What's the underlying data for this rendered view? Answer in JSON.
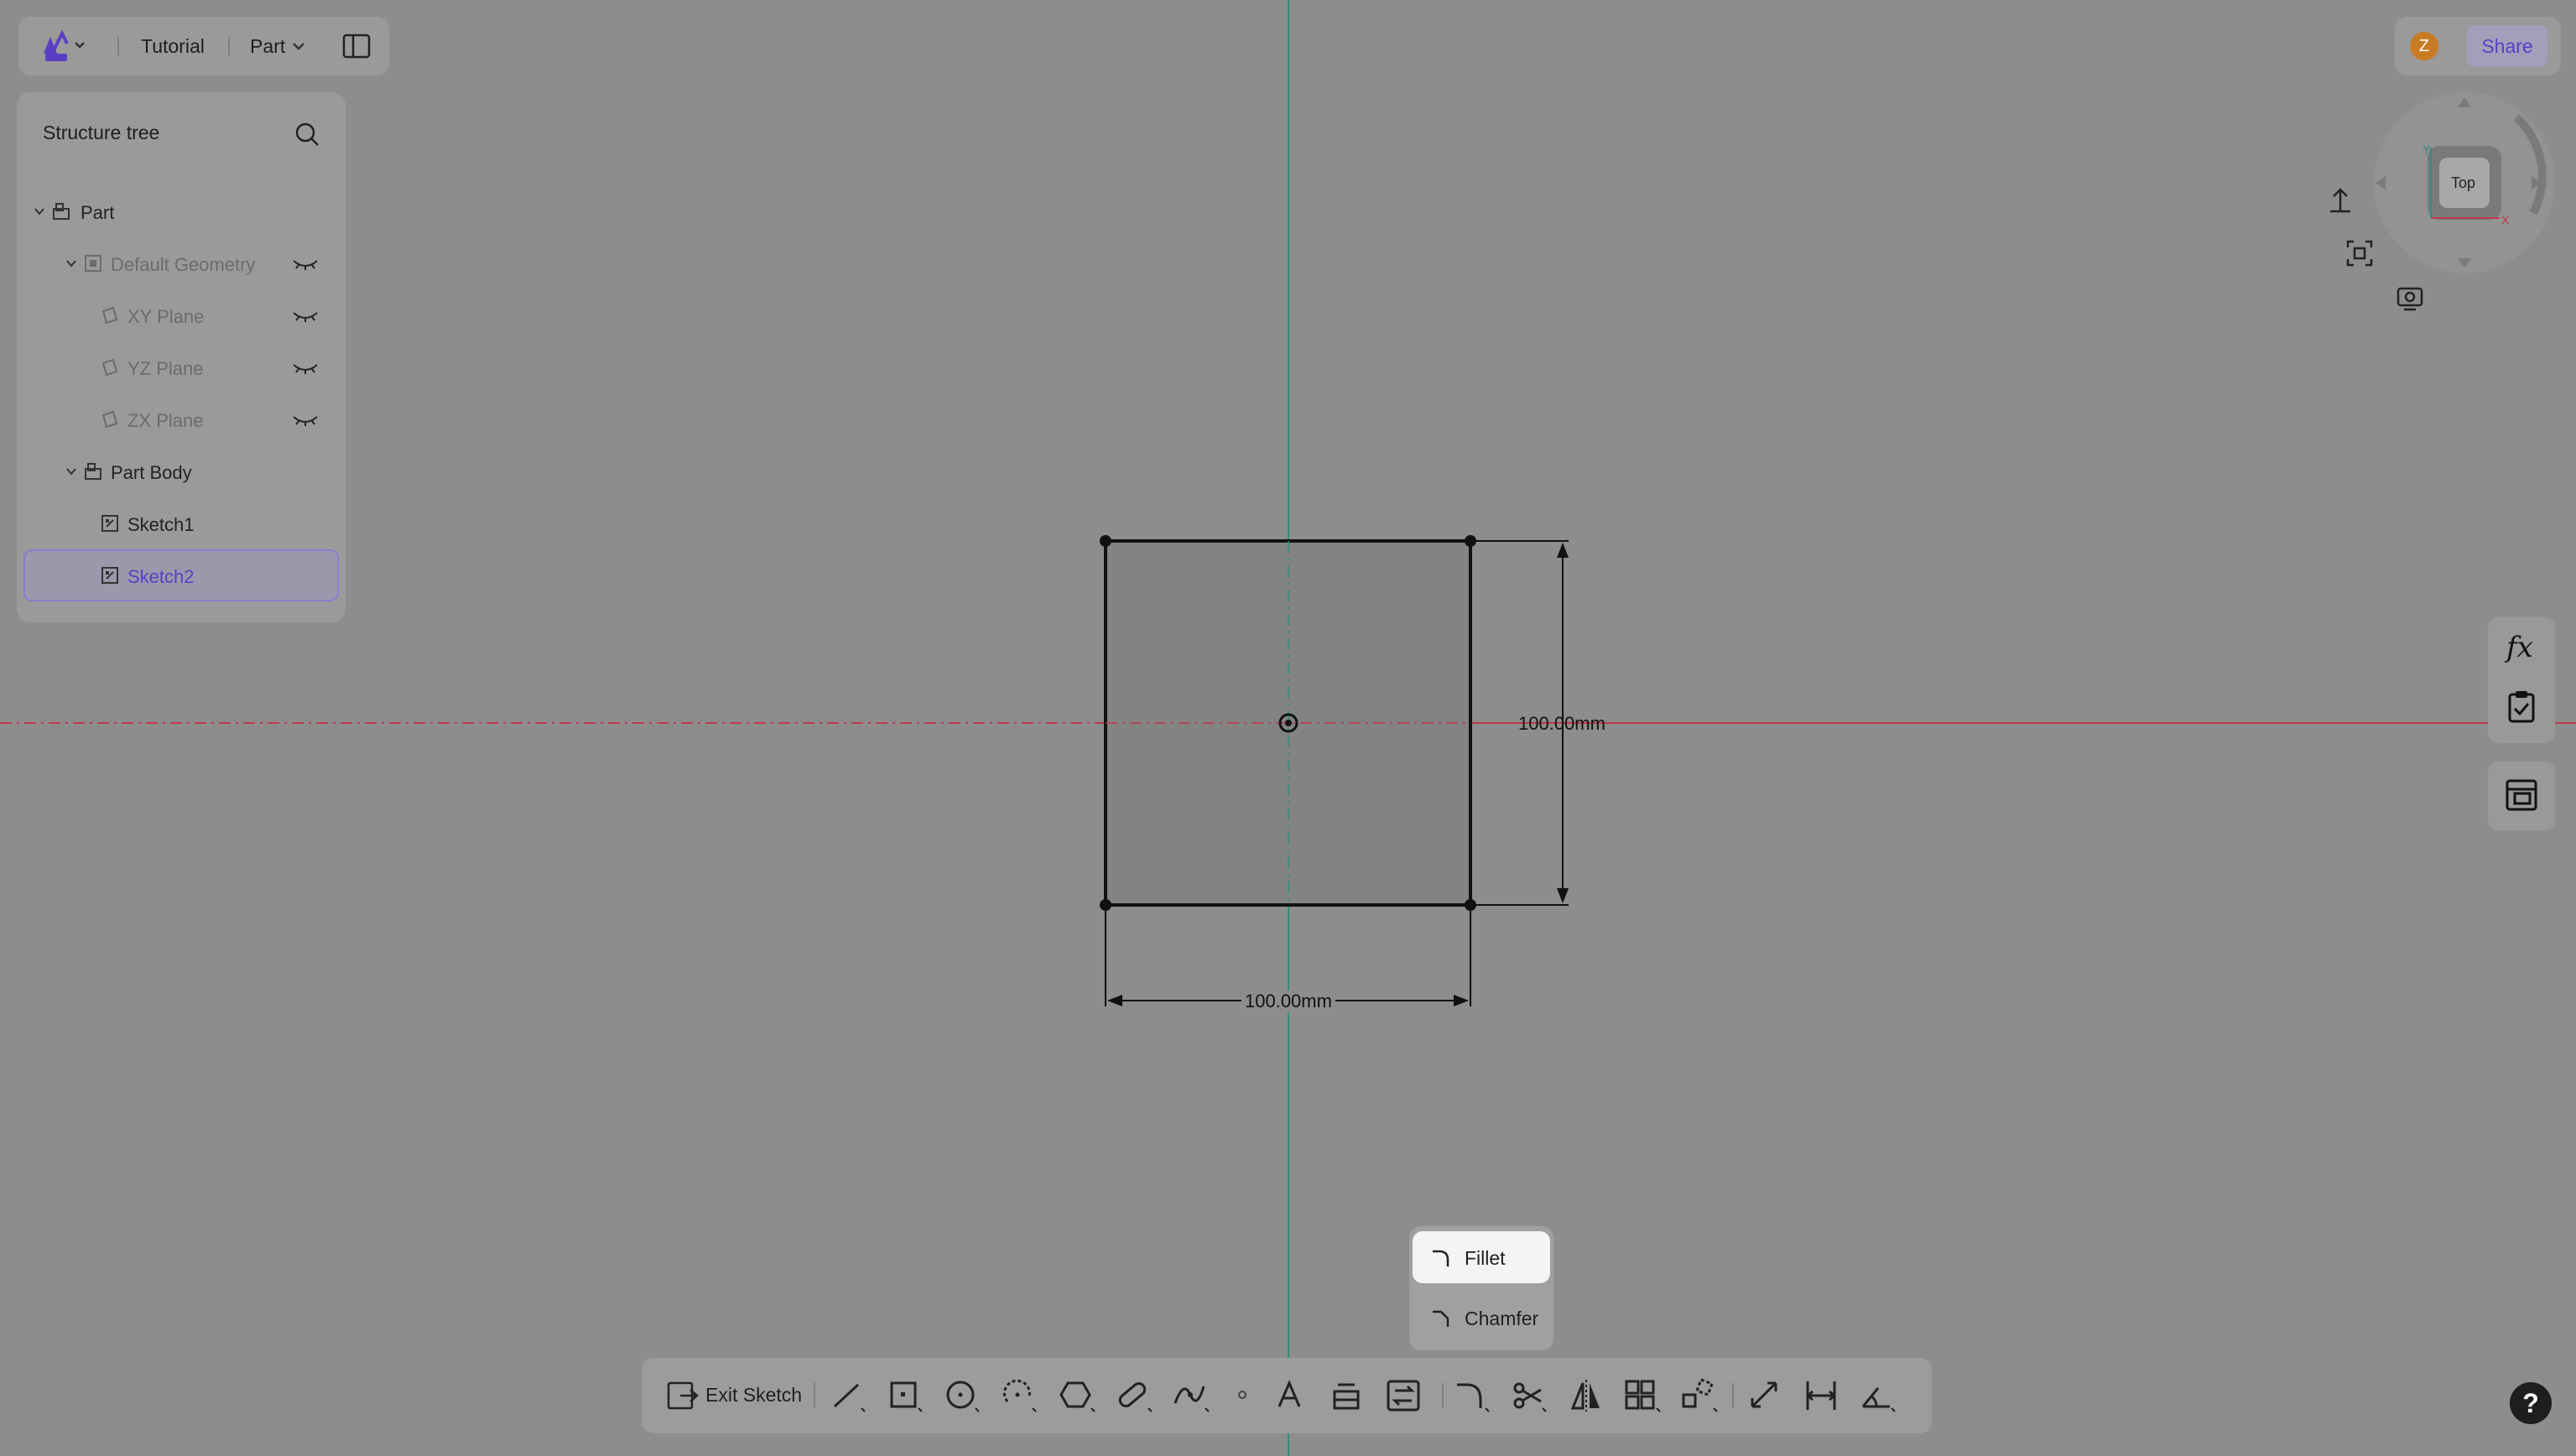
{
  "topbar": {
    "project": "Tutorial",
    "workspace": "Part"
  },
  "tree": {
    "title": "Structure tree",
    "items": [
      {
        "label": "Part"
      },
      {
        "label": "Default Geometry"
      },
      {
        "label": "XY Plane"
      },
      {
        "label": "YZ Plane"
      },
      {
        "label": "ZX Plane"
      },
      {
        "label": "Part Body"
      },
      {
        "label": "Sketch1"
      },
      {
        "label": "Sketch2"
      }
    ]
  },
  "header_right": {
    "avatar_initial": "Z",
    "share_label": "Share"
  },
  "viewcube": {
    "face": "Top",
    "axis_x": "X",
    "axis_y": "Y"
  },
  "sketch": {
    "width_dim": "100.00mm",
    "height_dim": "100.00mm"
  },
  "popup": {
    "fillet": "Fillet",
    "chamfer": "Chamfer"
  },
  "toolbar": {
    "exit_label": "Exit Sketch"
  },
  "right_dock": {
    "formula_label": "fx"
  },
  "help": {
    "label": "?"
  },
  "colors": {
    "accent": "#5a3fc5",
    "x_axis": "#c0394a",
    "y_axis": "#2f8f7f"
  }
}
